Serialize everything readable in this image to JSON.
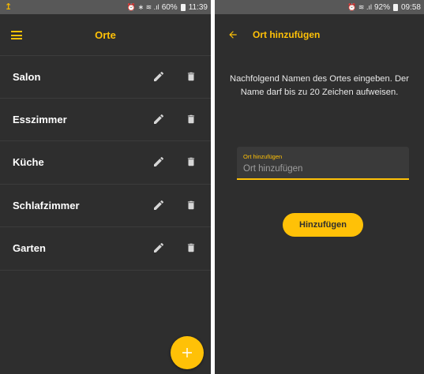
{
  "left": {
    "status": {
      "left_icon": "↥",
      "glyphs": "⏰ ∗ ≋ .ıl",
      "battery": "60%",
      "time": "11:39"
    },
    "appbar": {
      "title": "Orte"
    },
    "list": [
      {
        "label": "Salon"
      },
      {
        "label": "Esszimmer"
      },
      {
        "label": "Küche"
      },
      {
        "label": "Schlafzimmer"
      },
      {
        "label": "Garten"
      }
    ],
    "fab": {
      "icon": "plus-icon"
    }
  },
  "right": {
    "status": {
      "glyphs": "⏰ ≋ .ıl",
      "battery": "92%",
      "time": "09:58"
    },
    "appbar": {
      "title": "Ort hinzufügen"
    },
    "instructions": "Nachfolgend Namen des Ortes eingeben. Der Name darf bis zu 20 Zeichen aufweisen.",
    "field": {
      "label": "Ort hinzufügen",
      "placeholder": "Ort hinzufügen"
    },
    "button": {
      "label": "Hinzufügen"
    }
  },
  "colors": {
    "accent": "#ffc107",
    "background": "#2e2e2e",
    "statusbar": "#585858",
    "text": "#ffffff"
  }
}
